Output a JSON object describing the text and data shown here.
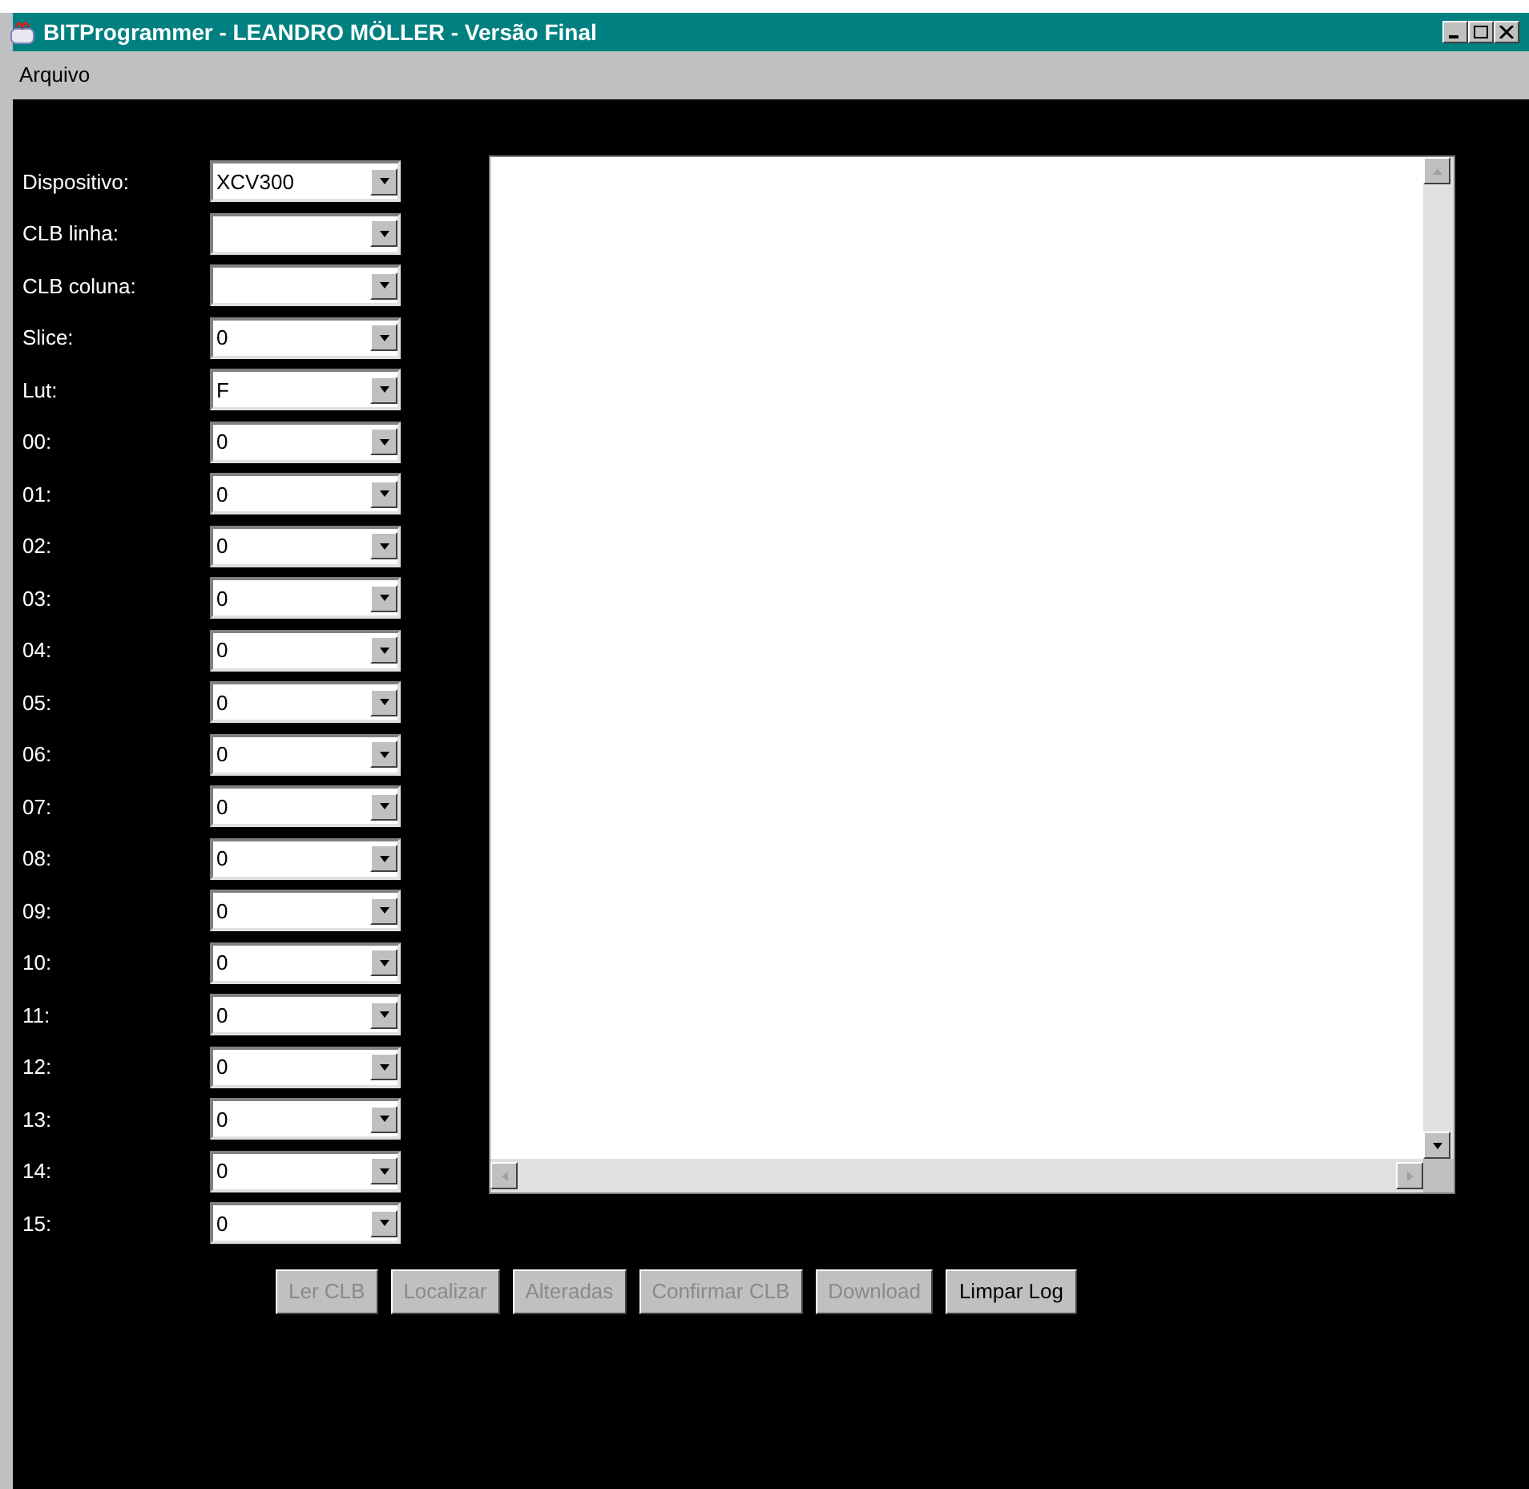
{
  "window": {
    "title": "BITProgrammer - LEANDRO MÖLLER - Versão Final"
  },
  "menu": [
    "Arquivo"
  ],
  "fields": [
    {
      "label": "Dispositivo:",
      "value": "XCV300"
    },
    {
      "label": "CLB linha:"
    },
    {
      "label": "CLB coluna:"
    },
    {
      "label": "Slice:",
      "value": "0"
    },
    {
      "label": "Lut:",
      "value": "F"
    },
    {
      "label": "00:",
      "value": "0"
    },
    {
      "label": "01:",
      "value": "0"
    },
    {
      "label": "02:",
      "value": "0"
    },
    {
      "label": "03:",
      "value": "0"
    },
    {
      "label": "04:",
      "value": "0"
    },
    {
      "label": "05:",
      "value": "0"
    },
    {
      "label": "06:",
      "value": "0"
    },
    {
      "label": "07:",
      "value": "0"
    },
    {
      "label": "08:",
      "value": "0"
    },
    {
      "label": "09:",
      "value": "0"
    },
    {
      "label": "10:",
      "value": "0"
    },
    {
      "label": "11:",
      "value": "0"
    },
    {
      "label": "12:",
      "value": "0"
    },
    {
      "label": "13:",
      "value": "0"
    },
    {
      "label": "14:",
      "value": "0"
    },
    {
      "label": "15:",
      "value": "0"
    }
  ],
  "buttons": [
    {
      "label": "Ler CLB",
      "disabled": true
    },
    {
      "label": "Localizar",
      "disabled": true
    },
    {
      "label": "Alteradas",
      "disabled": true
    },
    {
      "label": "Confirmar CLB",
      "disabled": true
    },
    {
      "label": "Download",
      "disabled": true
    },
    {
      "label": "Limpar Log",
      "disabled": false
    }
  ]
}
